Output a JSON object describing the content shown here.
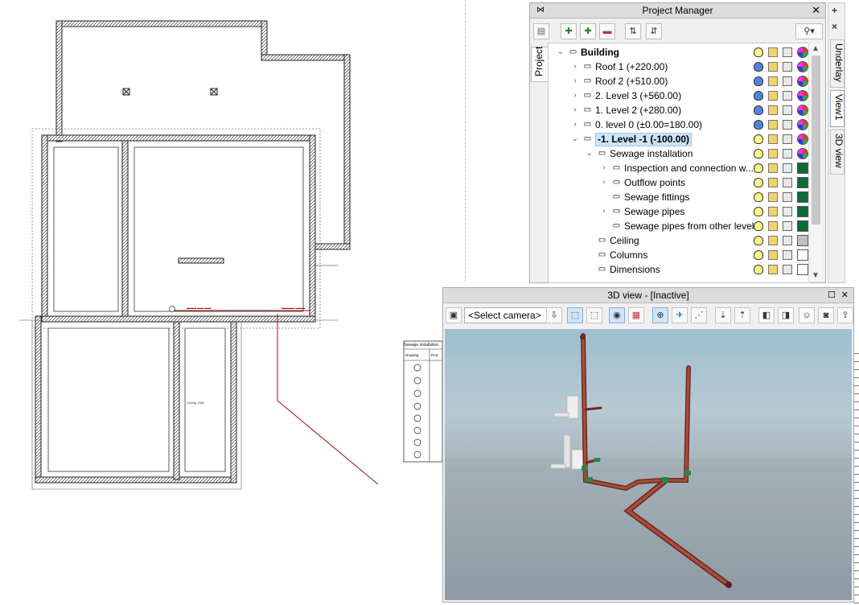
{
  "cad": {
    "room_label": "Ceiling  1500",
    "legend_title": "Sewage installation",
    "legend_col1": "Drawing",
    "legend_col2": "Proc"
  },
  "project_manager": {
    "title": "Project Manager",
    "side_tab": "Project",
    "tree": [
      {
        "label": "Building",
        "level": 0,
        "expander": "open",
        "bold": true,
        "icon": "house-icon",
        "bulb": "yellow",
        "color": "multi"
      },
      {
        "label": "Roof 1 (+220.00)",
        "level": 1,
        "expander": "closed",
        "icon": "roof-icon",
        "bulb": "blue",
        "color": "multi"
      },
      {
        "label": "Roof 2 (+510.00)",
        "level": 1,
        "expander": "closed",
        "icon": "roof-icon",
        "bulb": "blue",
        "color": "multi"
      },
      {
        "label": "2. Level 3 (+560.00)",
        "level": 1,
        "expander": "closed",
        "icon": "level-icon",
        "bulb": "blue",
        "color": "multi"
      },
      {
        "label": "1. Level 2 (+280.00)",
        "level": 1,
        "expander": "closed",
        "icon": "level-icon",
        "bulb": "blue",
        "color": "multi"
      },
      {
        "label": "0. level 0 (±0.00=180.00)",
        "level": 1,
        "expander": "closed",
        "icon": "level-icon",
        "bulb": "blue",
        "color": "multi"
      },
      {
        "label": "-1. Level -1 (-100.00)",
        "level": 1,
        "expander": "open",
        "bold": true,
        "selected": true,
        "icon": "level-active-icon",
        "bulb": "yellow",
        "color": "multi"
      },
      {
        "label": "Sewage installation",
        "level": 2,
        "expander": "open",
        "icon": "sewage-installation-icon",
        "bulb": "yellow",
        "color": "multi"
      },
      {
        "label": "Inspection and connection w...",
        "level": 3,
        "expander": "closed",
        "icon": "inspection-icon",
        "bulb": "yellow",
        "color": "green"
      },
      {
        "label": "Outflow points",
        "level": 3,
        "expander": "closed",
        "icon": "outflow-icon",
        "bulb": "yellow",
        "color": "green"
      },
      {
        "label": "Sewage fittings",
        "level": 3,
        "expander": "none",
        "icon": "fitting-icon",
        "bulb": "yellow",
        "color": "green"
      },
      {
        "label": "Sewage pipes",
        "level": 3,
        "expander": "closed",
        "icon": "pipe-icon",
        "bulb": "yellow",
        "color": "green"
      },
      {
        "label": "Sewage pipes from other levels",
        "level": 3,
        "expander": "none",
        "icon": "pipe-other-icon",
        "bulb": "yellow",
        "color": "green"
      },
      {
        "label": "Ceiling",
        "level": 2,
        "expander": "none",
        "icon": "ceiling-icon",
        "bulb": "yellow",
        "color": "grey"
      },
      {
        "label": "Columns",
        "level": 2,
        "expander": "none",
        "icon": "columns-icon",
        "bulb": "yellow",
        "color": "white"
      },
      {
        "label": "Dimensions",
        "level": 2,
        "expander": "none",
        "icon": "dimensions-icon",
        "bulb": "yellow",
        "color": "white"
      }
    ]
  },
  "dock_tabs": [
    "Underlay",
    "View1",
    "3D view"
  ],
  "view3d": {
    "title": "3D view - [Inactive]",
    "camera_select": "<Select camera>"
  },
  "colors": {
    "pipe": "#8b3a2e",
    "fitting_green": "#1f8a4a",
    "layer_green": "#0e6b34",
    "selection": "#cce4f7"
  }
}
